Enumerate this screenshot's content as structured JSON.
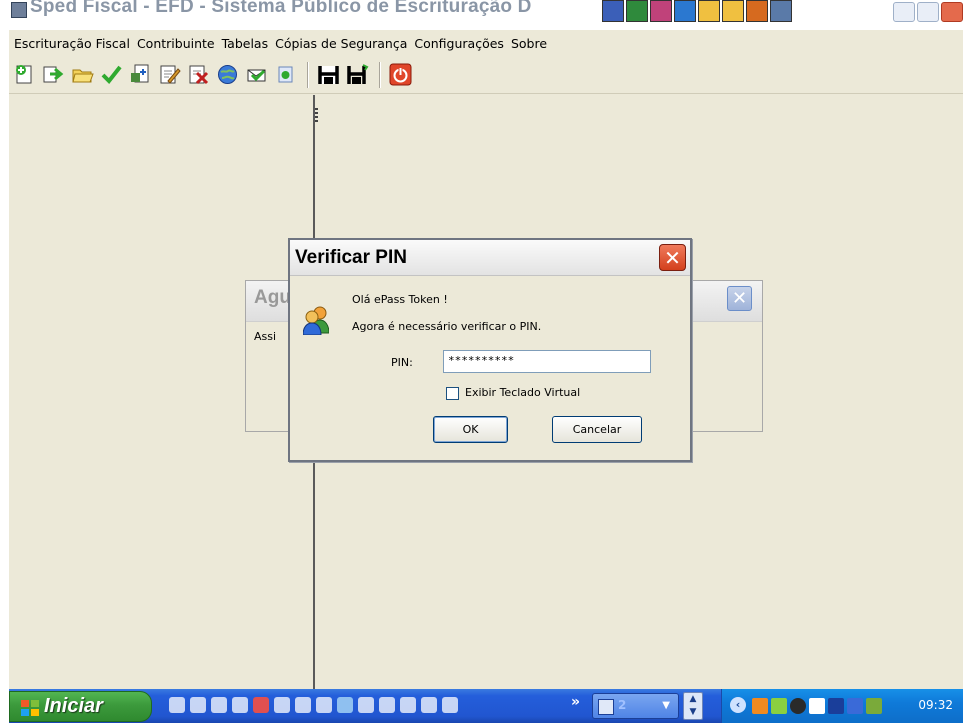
{
  "window": {
    "title": "Sped Fiscal - EFD - Sistema Público de Escrituração D"
  },
  "menu": {
    "items": [
      "Escrituração Fiscal",
      "Contribuinte",
      "Tabelas",
      "Cópias de Segurança",
      "Configurações",
      "Sobre"
    ]
  },
  "toolbar": {
    "buttons": [
      "new-icon",
      "forward-arrow-icon",
      "open-folder-icon",
      "validate-check-icon",
      "import-icon",
      "edit-report-icon",
      "delete-report-icon",
      "globe-icon",
      "transmit-icon",
      "recibo-icon",
      "save-icon",
      "save-as-icon",
      "power-icon"
    ]
  },
  "aguarde_dialog": {
    "title": "Agu",
    "body_text": "Assi"
  },
  "pin_dialog": {
    "title": "Verificar PIN",
    "greeting": "Olá ePass Token !",
    "instruction": "Agora é necessário verificar o PIN.",
    "pin_label": "PIN:",
    "pin_value": "**********",
    "virtual_keyboard_label": "Exibir Teclado Virtual",
    "virtual_keyboard_checked": false,
    "ok_label": "OK",
    "cancel_label": "Cancelar"
  },
  "taskbar": {
    "start_label": "Iniciar",
    "task_group_count": "2",
    "clock": "09:32"
  },
  "colors": {
    "taskbar_blue": "#245edb",
    "start_green": "#3c9a3c",
    "close_red": "#d3401d",
    "window_bg": "#ece9d8"
  }
}
